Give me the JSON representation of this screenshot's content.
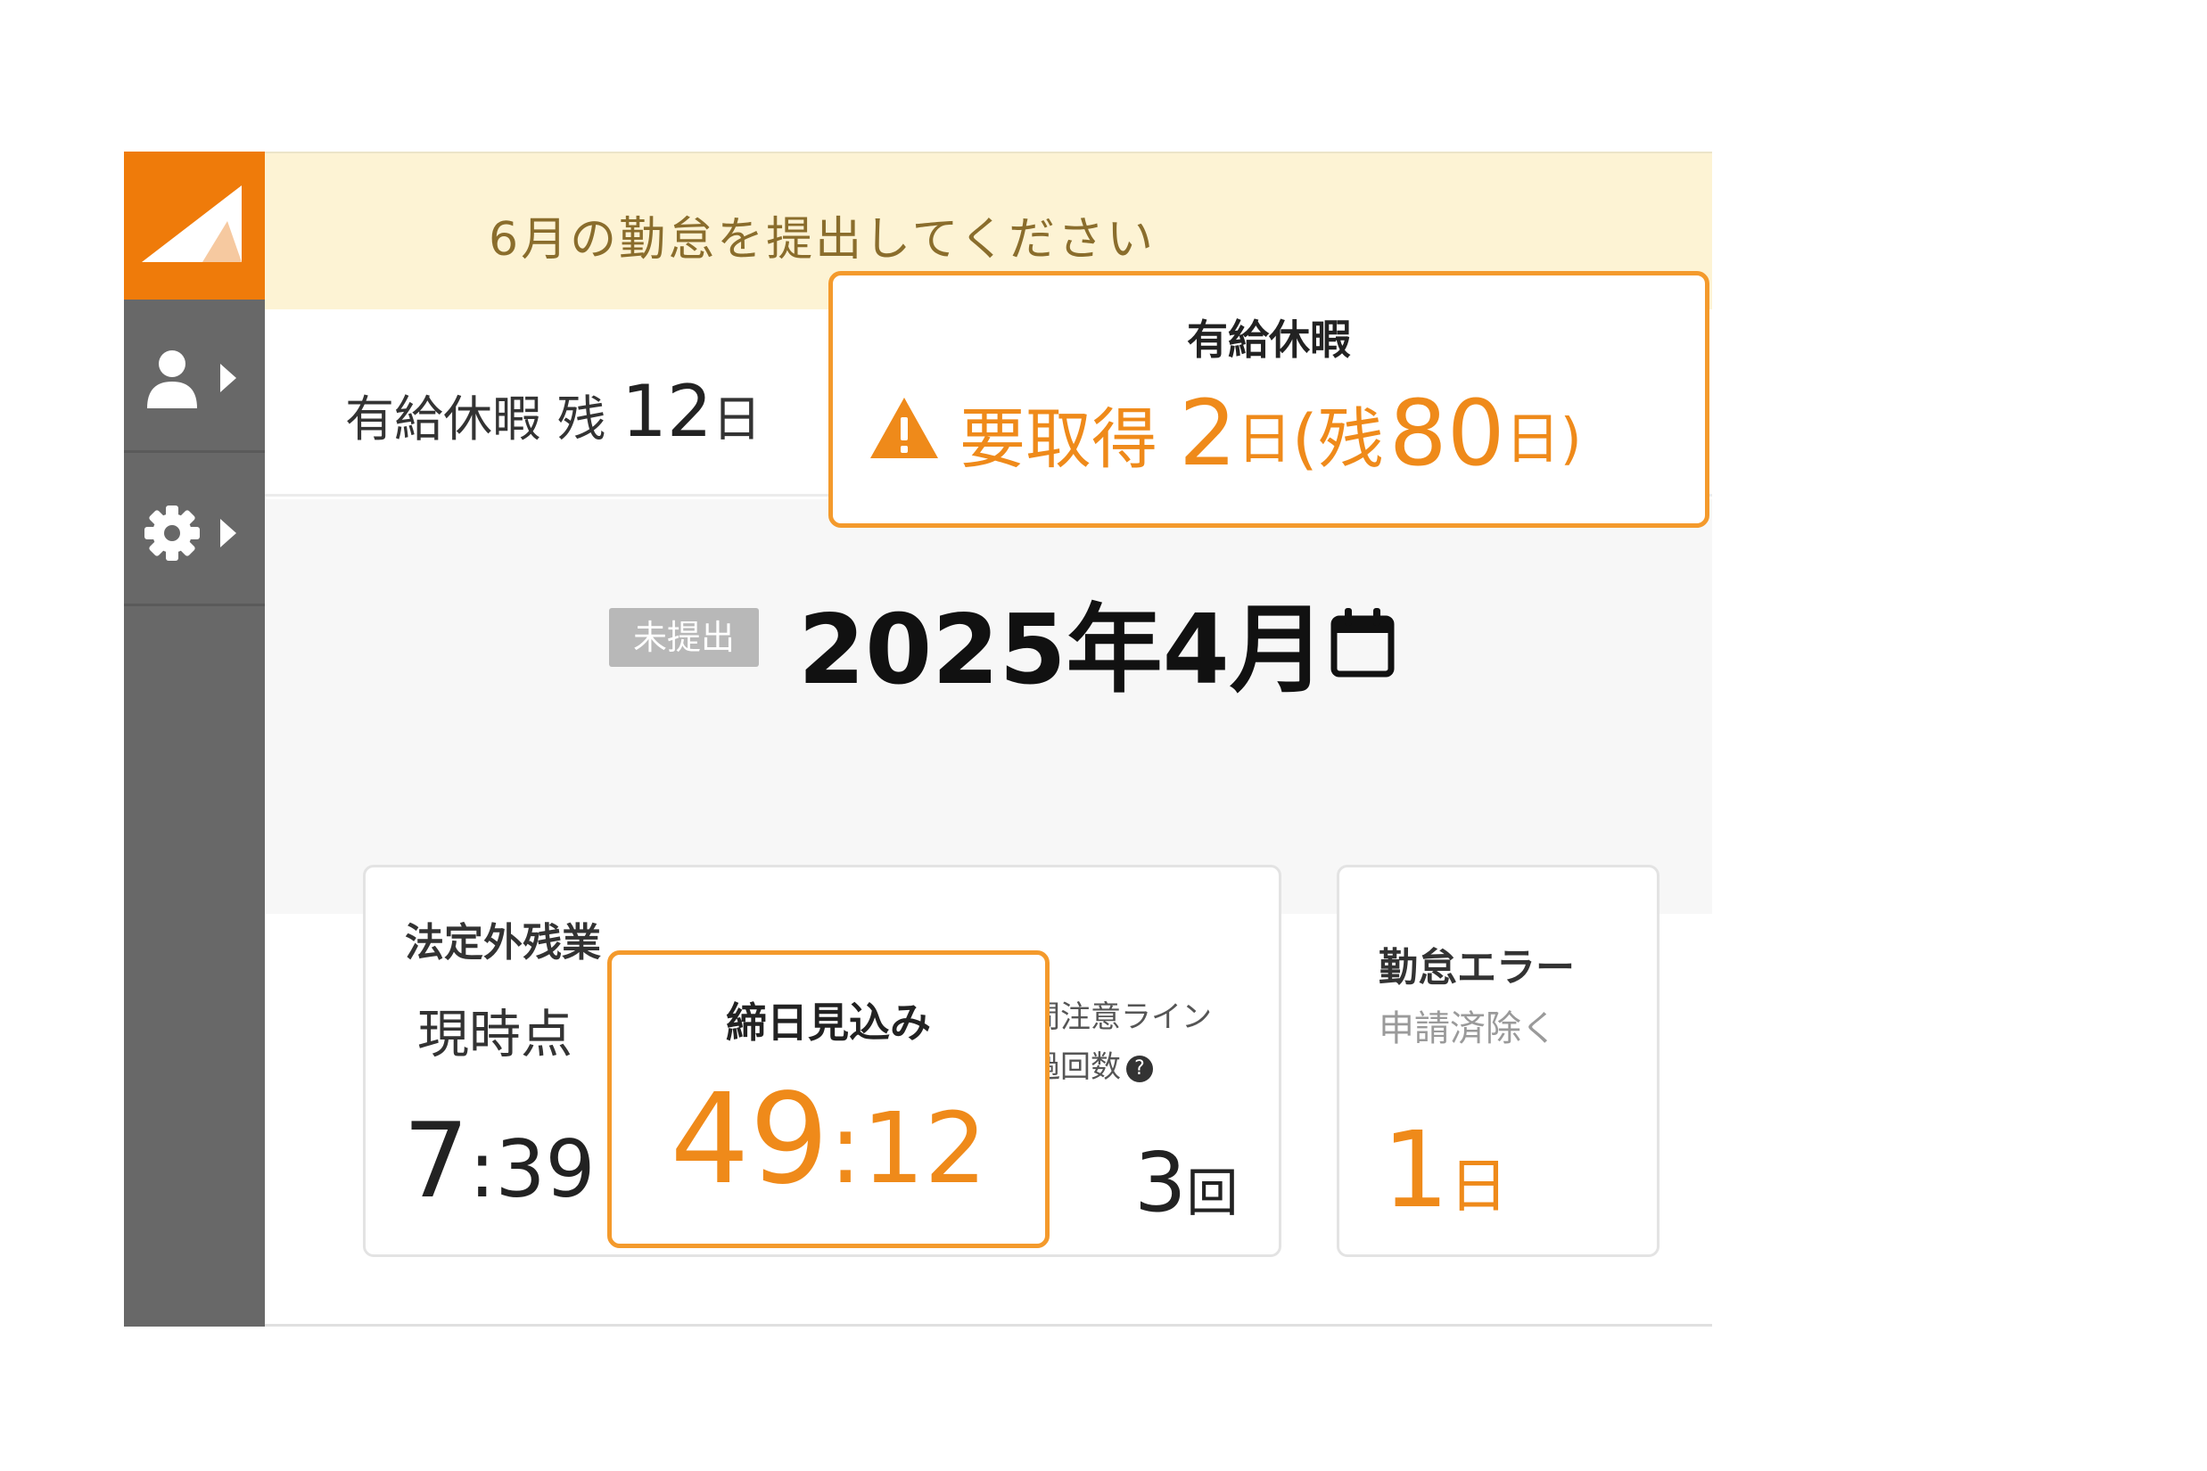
{
  "colors": {
    "accent": "#ef7b0a",
    "callout_border": "#f49a2c",
    "sidebar": "#686868",
    "banner_bg": "#fdf3d4",
    "status_badge": "#b8b8b8"
  },
  "sidebar": {
    "logo_icon": "app-logo",
    "items": [
      {
        "icon": "user-icon",
        "caret": "caret-right-icon"
      },
      {
        "icon": "gear-icon",
        "caret": "caret-right-icon"
      }
    ]
  },
  "banner": {
    "text": "6月の勤怠を提出してください"
  },
  "paid_leave_row": {
    "label": "有給休暇 残",
    "value": "12",
    "unit": "日"
  },
  "paid_leave_callout": {
    "title": "有給休暇",
    "icon": "warning-icon",
    "required_label": "要取得",
    "required_value": "2",
    "required_unit": "日",
    "paren_open": "(残",
    "remaining_value": "80",
    "remaining_unit": "日)"
  },
  "period": {
    "status": "未提出",
    "title": "2025年4月",
    "calendar_icon": "calendar-icon"
  },
  "overtime_card": {
    "title": "法定外残業",
    "current_label": "現時点",
    "current_hours": "7",
    "current_minutes": ":39",
    "line_label_1": "間注意ライン",
    "line_label_2": "過回数",
    "help_icon": "?",
    "line_count": "3",
    "line_unit": "回"
  },
  "forecast_callout": {
    "title": "締日見込み",
    "hours": "49",
    "minutes": ":12"
  },
  "error_card": {
    "title": "勤怠エラー",
    "subtitle": "申請済除く",
    "value": "1",
    "unit": "日"
  }
}
